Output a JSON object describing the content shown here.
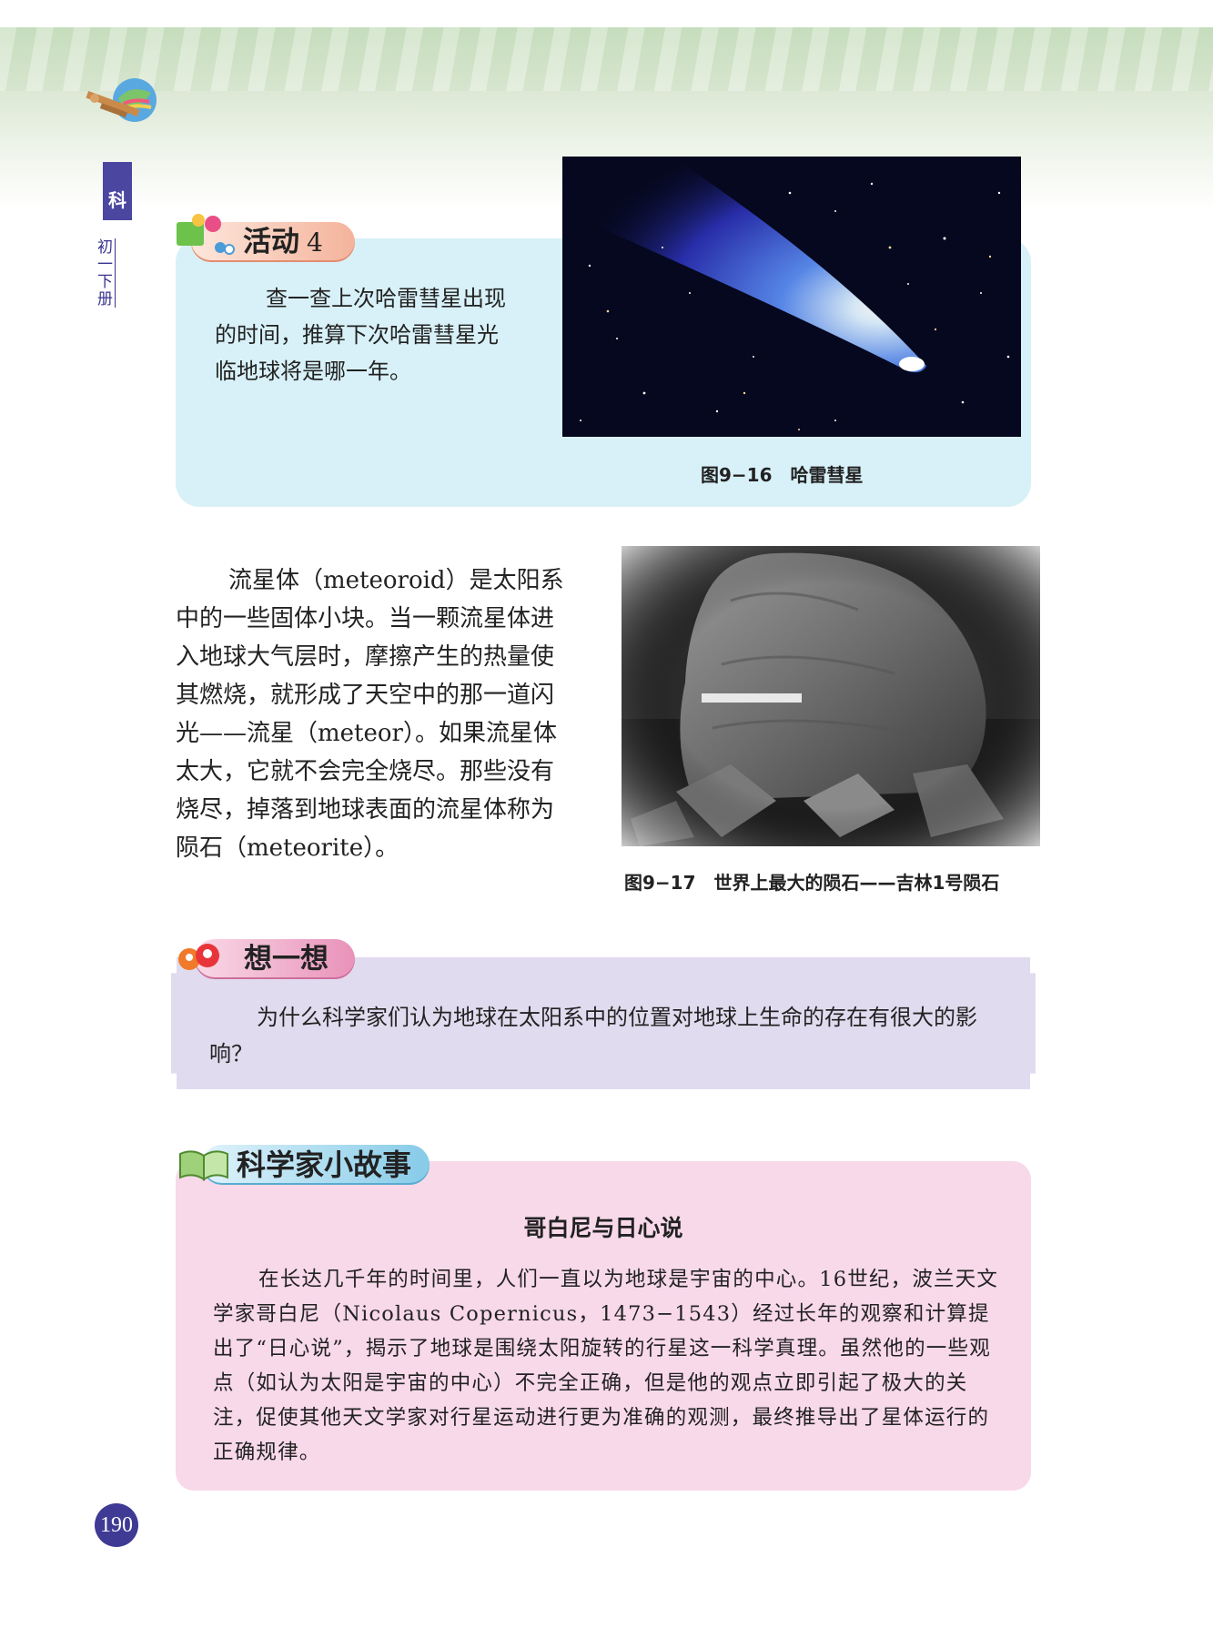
{
  "header": {
    "side_tab": "科",
    "side_text": "初一下册"
  },
  "activity": {
    "title": "活动",
    "number": "4",
    "text": "查一查上次哈雷彗星出现的时间，推算下次哈雷彗星光临地球将是哪一年。",
    "figure_caption": "图9−16　哈雷彗星"
  },
  "main": {
    "paragraph": "流星体（meteoroid）是太阳系中的一些固体小块。当一颗流星体进入地球大气层时，摩擦产生的热量使其燃烧，就形成了天空中的那一道闪光——流星（meteor）。如果流星体太大，它就不会完全烧尽。那些没有烧尽，掉落到地球表面的流星体称为陨石（meteorite）。",
    "figure_caption": "图9−17　世界上最大的陨石——吉林1号陨石"
  },
  "think": {
    "title": "想一想",
    "text": "为什么科学家们认为地球在太阳系中的位置对地球上生命的存在有很大的影响？"
  },
  "story": {
    "title": "科学家小故事",
    "heading": "哥白尼与日心说",
    "text": "在长达几千年的时间里，人们一直以为地球是宇宙的中心。16世纪，波兰天文学家哥白尼（Nicolaus Copernicus，1473−1543）经过长年的观察和计算提出了“日心说”，揭示了地球是围绕太阳旋转的行星这一科学真理。虽然他的一些观点（如认为太阳是宇宙的中心）不完全正确，但是他的观点立即引起了极大的关注，促使其他天文学家对行星运动进行更为准确的观测，最终推导出了星体运行的正确规律。"
  },
  "page_number": "190"
}
